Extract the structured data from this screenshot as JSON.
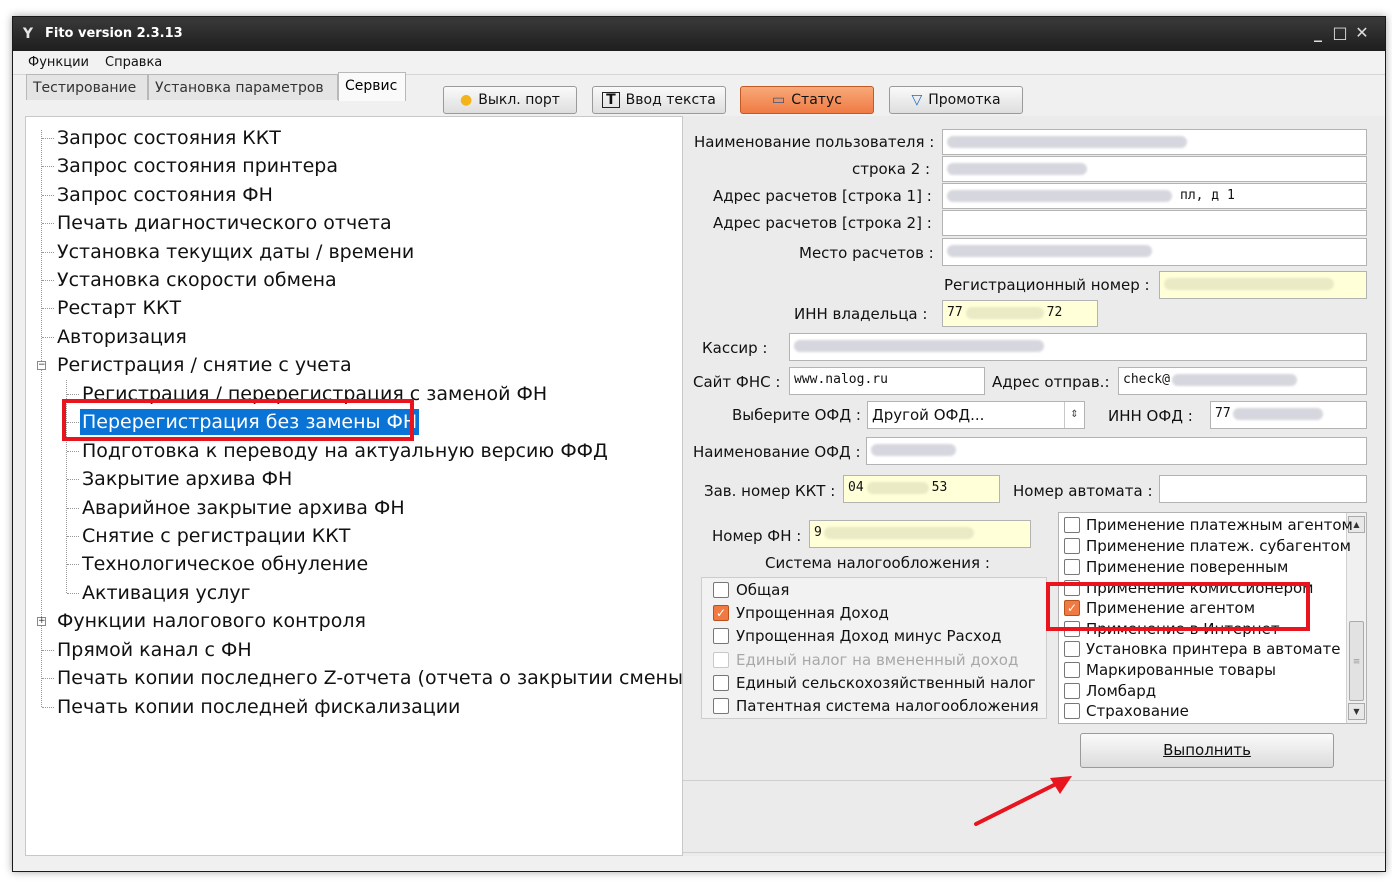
{
  "window": {
    "title": "Fito version 2.3.13",
    "controls": [
      "_",
      "□",
      "✕"
    ]
  },
  "menu": [
    "Функции",
    "Справка"
  ],
  "tabs": [
    "Тестирование",
    "Установка параметров",
    "Сервис"
  ],
  "toolbar": {
    "port": "Выкл. порт",
    "text_input": "Ввод текста",
    "status": "Статус",
    "rewind": "Промотка"
  },
  "tree": {
    "items": [
      "Запрос состояния ККТ",
      "Запрос состояния принтера",
      "Запрос состояния ФН",
      "Печать диагностического отчета",
      "Установка текущих даты / времени",
      "Установка скорости обмена",
      "Рестарт ККТ",
      "Авторизация",
      "Регистрация / снятие с учета"
    ],
    "sub_items": [
      "Регистрация / перерегистрация с заменой ФН",
      "Перерегистрация без замены ФН",
      "Подготовка к переводу на актуальную версию ФФД",
      "Закрытие архива ФН",
      "Аварийное закрытие архива ФН",
      "Снятие с регистрации ККТ",
      "Технологическое обнуление",
      "Активация услуг"
    ],
    "tail_items": [
      "Функции налогового контроля",
      "Прямой канал с ФН",
      "Печать копии последнего Z-отчета (отчета о закрытии смены)",
      "Печать копии последней фискализации"
    ],
    "expander_open": "−",
    "expander_closed": "+"
  },
  "form": {
    "user_name_label": "Наименование пользователя :",
    "line2_label": "строка 2 :",
    "address1_label": "Адрес расчетов [строка 1] :",
    "address1_suffix": "пл, д 1",
    "address2_label": "Адрес расчетов [строка 2] :",
    "place_label": "Место расчетов :",
    "reg_number_label": "Регистрационный номер :",
    "owner_inn_label": "ИНН владельца :",
    "owner_inn_start": "77",
    "owner_inn_end": "72",
    "cashier_label": "Кассир  :",
    "fns_site_label": "Сайт ФНС :",
    "fns_site_value": "www.nalog.ru",
    "sender_label": "Адрес отправ.:",
    "sender_value": "check@",
    "ofd_select_label": "Выберите ОФД :",
    "ofd_select_value": "Другой ОФД...",
    "ofd_inn_label": "ИНН ОФД :",
    "ofd_inn_value": "77",
    "ofd_name_label": "Наименование ОФД :",
    "kkt_serial_label": "Зав. номер ККТ :",
    "kkt_serial_start": "04",
    "kkt_serial_end": "53",
    "machine_number_label": "Номер автомата :",
    "fn_number_label": "Номер ФН :",
    "fn_number_value": "9",
    "tax_system_label": "Система  налогообложения :"
  },
  "tax_options": [
    {
      "label": "Общая",
      "checked": false,
      "disabled": false
    },
    {
      "label": "Упрощенная Доход",
      "checked": true,
      "disabled": false
    },
    {
      "label": "Упрощенная Доход минус Расход",
      "checked": false,
      "disabled": false
    },
    {
      "label": "Единый налог на вмененный доход",
      "checked": false,
      "disabled": true
    },
    {
      "label": "Единый сельскохозяйственный налог",
      "checked": false,
      "disabled": false
    },
    {
      "label": "Патентная система налогообложения",
      "checked": false,
      "disabled": false
    }
  ],
  "features": [
    {
      "label": "Применение платежным агентом",
      "checked": false
    },
    {
      "label": "Применение платеж. субагентом",
      "checked": false
    },
    {
      "label": "Применение поверенным",
      "checked": false
    },
    {
      "label": "Применение комиссионером",
      "checked": false
    },
    {
      "label": "Применение агентом",
      "checked": true
    },
    {
      "label": "Применение в Интернет",
      "checked": false
    },
    {
      "label": "Установка принтера в автомате",
      "checked": false
    },
    {
      "label": "Маркированные товары",
      "checked": false
    },
    {
      "label": "Ломбард",
      "checked": false
    },
    {
      "label": "Страхование",
      "checked": false
    }
  ],
  "execute_label": "Выполнить",
  "check_glyph": "✓",
  "icons": {
    "lamp": "●",
    "text": "T",
    "status": "▭",
    "rewind": "▽",
    "scroll_up": "▲",
    "scroll_down": "▼",
    "grip": "≡",
    "select_arrow": "⇕",
    "app": "Y"
  },
  "colors": {
    "highlight": "#e8141e",
    "selection": "#0a74d6",
    "status_btn": "#ef7b44"
  }
}
